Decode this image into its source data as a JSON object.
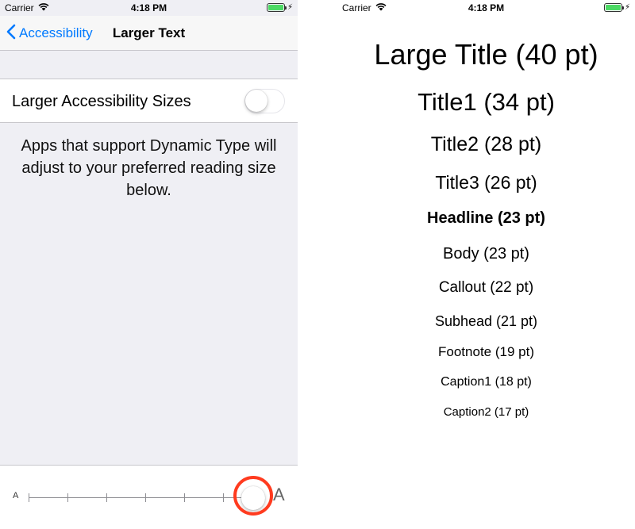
{
  "left_screen": {
    "status_bar": {
      "carrier": "Carrier",
      "time": "4:18 PM",
      "battery_color": "#4cd964",
      "icons": [
        "wifi-icon",
        "battery-icon",
        "charging-bolt-icon"
      ]
    },
    "nav": {
      "back_label": "Accessibility",
      "title": "Larger Text",
      "back_icon": "chevron-left-icon",
      "accent_color": "#007aff"
    },
    "larger_accessibility": {
      "label": "Larger Accessibility Sizes",
      "toggle_on": false
    },
    "footer_text": "Apps that support Dynamic Type will adjust to your preferred reading size below.",
    "slider": {
      "small_label": "A",
      "large_label": "A",
      "steps": 7,
      "selected_step": 7,
      "highlight_color": "#ff3b1f"
    }
  },
  "right_screen": {
    "status_bar": {
      "carrier": "Carrier",
      "time": "4:18 PM",
      "battery_color": "#4cd964",
      "icons": [
        "wifi-icon",
        "battery-icon",
        "charging-bolt-icon"
      ]
    },
    "text_styles": [
      {
        "label": "Large Title (40 pt)"
      },
      {
        "label": "Title1 (34 pt)"
      },
      {
        "label": "Title2 (28 pt)"
      },
      {
        "label": "Title3 (26 pt)"
      },
      {
        "label": "Headline (23 pt)"
      },
      {
        "label": "Body (23 pt)"
      },
      {
        "label": "Callout (22 pt)"
      },
      {
        "label": "Subhead (21 pt)"
      },
      {
        "label": "Footnote (19 pt)"
      },
      {
        "label": "Caption1 (18 pt)"
      },
      {
        "label": "Caption2 (17 pt)"
      }
    ]
  }
}
